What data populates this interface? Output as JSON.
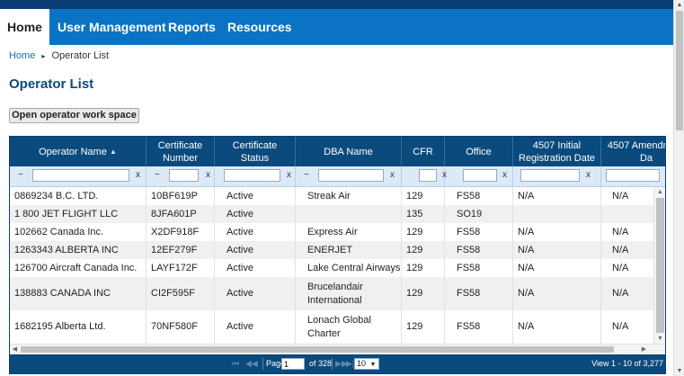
{
  "nav": {
    "tabs": [
      {
        "label": "Home"
      },
      {
        "label": "User Management"
      },
      {
        "label": "Reports"
      },
      {
        "label": "Resources"
      }
    ]
  },
  "breadcrumb": {
    "home": "Home",
    "current": "Operator List",
    "separator": "▸"
  },
  "page": {
    "title": "Operator List",
    "workspace_button": "Open operator work space"
  },
  "grid": {
    "columns": [
      {
        "label": "Operator Name",
        "sorted": true
      },
      {
        "label": "Certificate Number"
      },
      {
        "label": "Certificate Status"
      },
      {
        "label": "DBA Name"
      },
      {
        "label": "CFR"
      },
      {
        "label": "Office"
      },
      {
        "label": "4507 Initial Registration Date"
      },
      {
        "label": "4507 Amendment Da"
      }
    ],
    "filter": {
      "operator": "~",
      "clear": "x"
    },
    "rows": [
      [
        "0869234 B.C. LTD.",
        "10BF619P",
        "Active",
        "Streak Air",
        "129",
        "FS58",
        "N/A",
        "N/A"
      ],
      [
        "1 800 JET FLIGHT LLC",
        "8JFA601P",
        "Active",
        "",
        "135",
        "SO19",
        "",
        ""
      ],
      [
        "102662 Canada Inc.",
        "X2DF918F",
        "Active",
        "Express Air",
        "129",
        "FS58",
        "N/A",
        "N/A"
      ],
      [
        "1263343 ALBERTA INC",
        "12EF279F",
        "Active",
        "ENERJET",
        "129",
        "FS58",
        "N/A",
        "N/A"
      ],
      [
        "126700 Aircraft Canada Inc.",
        "LAYF172F",
        "Active",
        "Lake Central Airways",
        "129",
        "FS58",
        "N/A",
        "N/A"
      ],
      [
        "138883 CANADA INC",
        "CI2F595F",
        "Active",
        "Brucelandair International",
        "129",
        "FS58",
        "N/A",
        "N/A"
      ],
      [
        "1682195 Alberta Ltd.",
        "70NF580F",
        "Active",
        "Lonach Global Charter",
        "129",
        "FS58",
        "N/A",
        "N/A"
      ]
    ]
  },
  "pager": {
    "first": "⏮",
    "prev": "◀◀",
    "page_label": "Page",
    "page_value": "1",
    "of_label": "of 328",
    "next": "▶▶",
    "last": "▶|",
    "rows_per_page": "10",
    "view_text": "View 1 - 10 of 3,277"
  },
  "colors": {
    "nav": "#0a73c4",
    "nav_dark": "#0a3d73",
    "header": "#0a4a7c",
    "title": "#0a4a7c"
  }
}
